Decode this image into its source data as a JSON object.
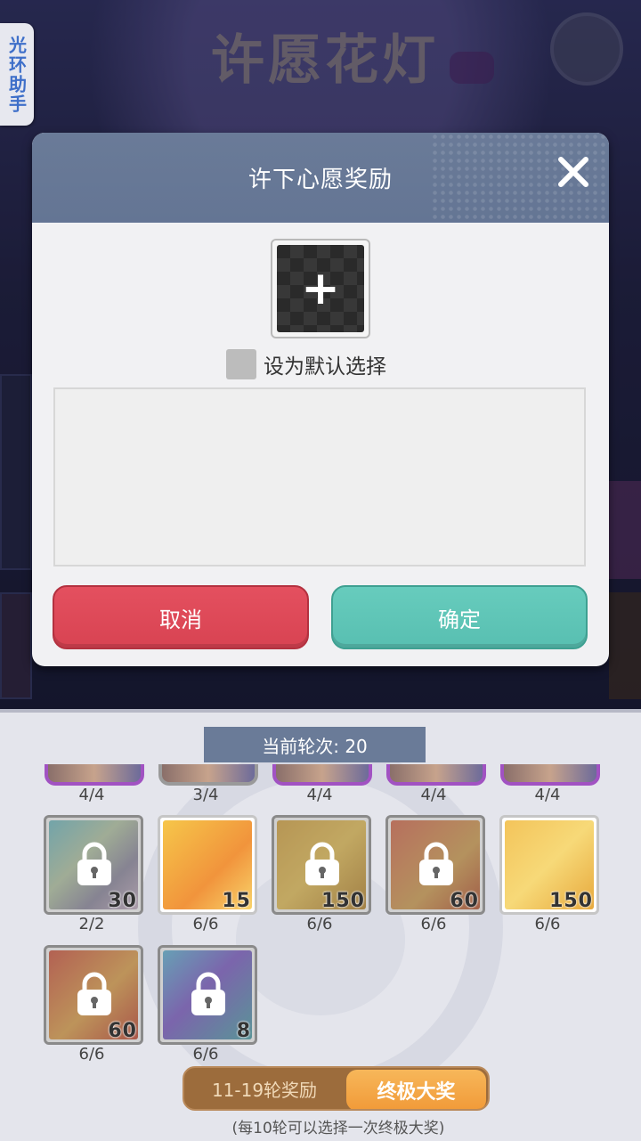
{
  "background": {
    "title": "许愿花灯"
  },
  "helper_tab": {
    "label": "光环助手"
  },
  "dialog": {
    "title": "许下心愿奖励",
    "close_icon": "close-icon",
    "slot_icon": "plus-icon",
    "slot_glyph": "+",
    "default_label": "设为默认选择",
    "description": "",
    "cancel_label": "取消",
    "confirm_label": "确定"
  },
  "panel": {
    "round_label": "当前轮次: 20",
    "prev_row_counts": [
      "4/4",
      "3/4",
      "4/4",
      "4/4",
      "4/4"
    ],
    "rewards": [
      {
        "icon": "material-icon",
        "qty": "30",
        "count": "2/2",
        "locked": true
      },
      {
        "icon": "ticket-icon",
        "qty": "15",
        "count": "6/6",
        "locked": false
      },
      {
        "icon": "gold-crate-icon",
        "qty": "150",
        "count": "6/6",
        "locked": true
      },
      {
        "icon": "treasure-chest-icon",
        "qty": "60",
        "count": "6/6",
        "locked": true
      },
      {
        "icon": "mystery-box-icon",
        "qty": "150",
        "count": "6/6",
        "locked": false
      },
      {
        "icon": "red-chest-icon",
        "qty": "60",
        "count": "6/6",
        "locked": true
      },
      {
        "icon": "gem-icon",
        "qty": "8",
        "count": "6/6",
        "locked": true
      }
    ],
    "tabs": {
      "normal": "11-19轮奖励",
      "final": "终极大奖"
    },
    "note": "(每10轮可以选择一次终极大奖)"
  }
}
